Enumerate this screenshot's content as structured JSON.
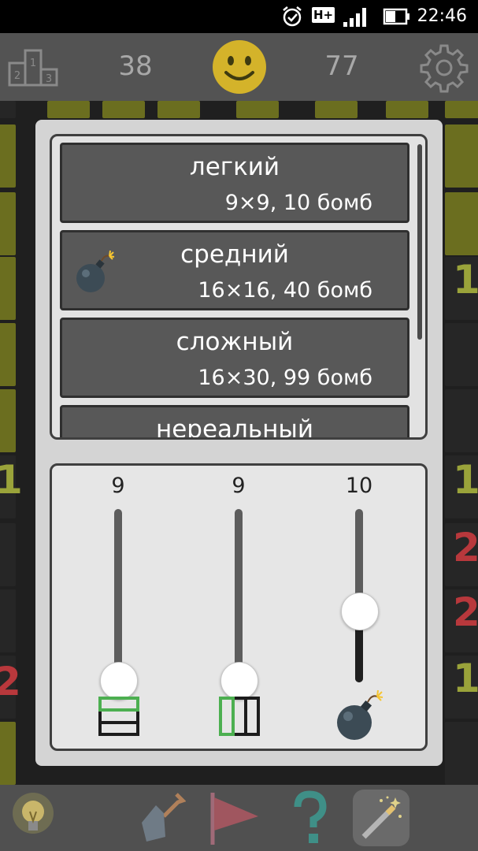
{
  "status_bar": {
    "time": "22:46",
    "network": "H+"
  },
  "top_bar": {
    "left_counter": "38",
    "right_counter": "77"
  },
  "board": {
    "visible_numbers": [
      "1",
      "1",
      "2",
      "2",
      "1",
      "2",
      "1"
    ]
  },
  "difficulty_list": {
    "levels": [
      {
        "name": "легкий",
        "desc": "9×9, 10 бомб"
      },
      {
        "name": "средний",
        "desc": "16×16, 40 бомб"
      },
      {
        "name": "сложный",
        "desc": "16×30, 99 бомб"
      },
      {
        "name": "нереальный",
        "desc": ""
      }
    ]
  },
  "custom_settings": {
    "rows": {
      "value": "9",
      "level": 0.0
    },
    "columns": {
      "value": "9",
      "level": 0.0
    },
    "bombs": {
      "value": "10",
      "level": 0.4
    }
  },
  "colors": {
    "accent": "#d4b32a",
    "closed_cell": "#6b6e1f",
    "number_one": "#9aa33a",
    "number_two": "#b8383c",
    "grid_icon_green": "#4caf50"
  }
}
